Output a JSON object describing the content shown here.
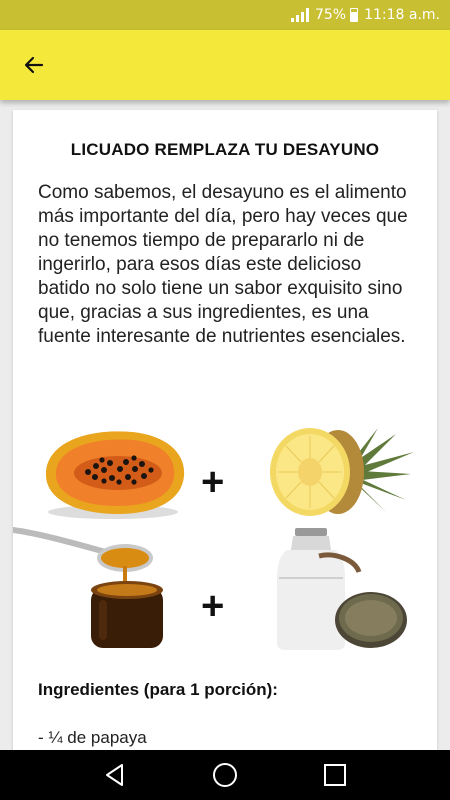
{
  "status_bar": {
    "battery_percent": "75%",
    "battery_level": 0.75,
    "time": "11:18 a.m."
  },
  "app_bar": {
    "back_icon": "arrow-left-icon",
    "background_color": "#f4e93b"
  },
  "article": {
    "title": "LICUADO REMPLAZA TU DESAYUNO",
    "intro": "Como sabemos, el desayuno es el alimento más importante del día, pero hay veces que no tenemos tiempo de prepararlo ni de ingerirlo, para esos días este delicioso batido no solo tiene un sabor exquisito sino que, gracias a sus ingredientes, es una fuente interesante de nutrientes esenciales.",
    "plus_sign_1": "+",
    "plus_sign_2": "+",
    "ingredients_heading": "Ingredientes (para 1 porción):",
    "ingredients": [
      "- ¼ de papaya"
    ]
  },
  "nav_bar": {
    "back_icon": "triangle-back-icon",
    "home_icon": "circle-home-icon",
    "recents_icon": "square-recents-icon"
  }
}
